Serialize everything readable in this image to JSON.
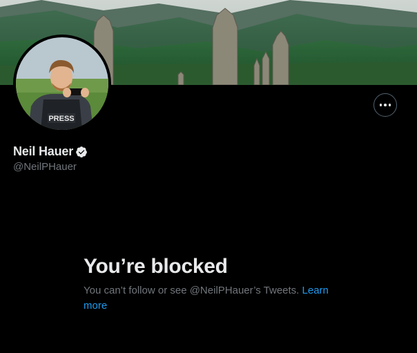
{
  "profile": {
    "name": "Neil Hauer",
    "handle": "@NeilPHauer",
    "verified": true,
    "avatar_badge_text": "PRESS"
  },
  "more_button": {
    "icon": "more-options-icon"
  },
  "blocked": {
    "title": "You’re blocked",
    "message": "You can’t follow or see @NeilPHauer’s Tweets.",
    "link_text": "Learn more"
  },
  "colors": {
    "background": "#000000",
    "text_primary": "#e7e9ea",
    "text_secondary": "#71767b",
    "link": "#1d9bf0",
    "border": "#536471"
  }
}
